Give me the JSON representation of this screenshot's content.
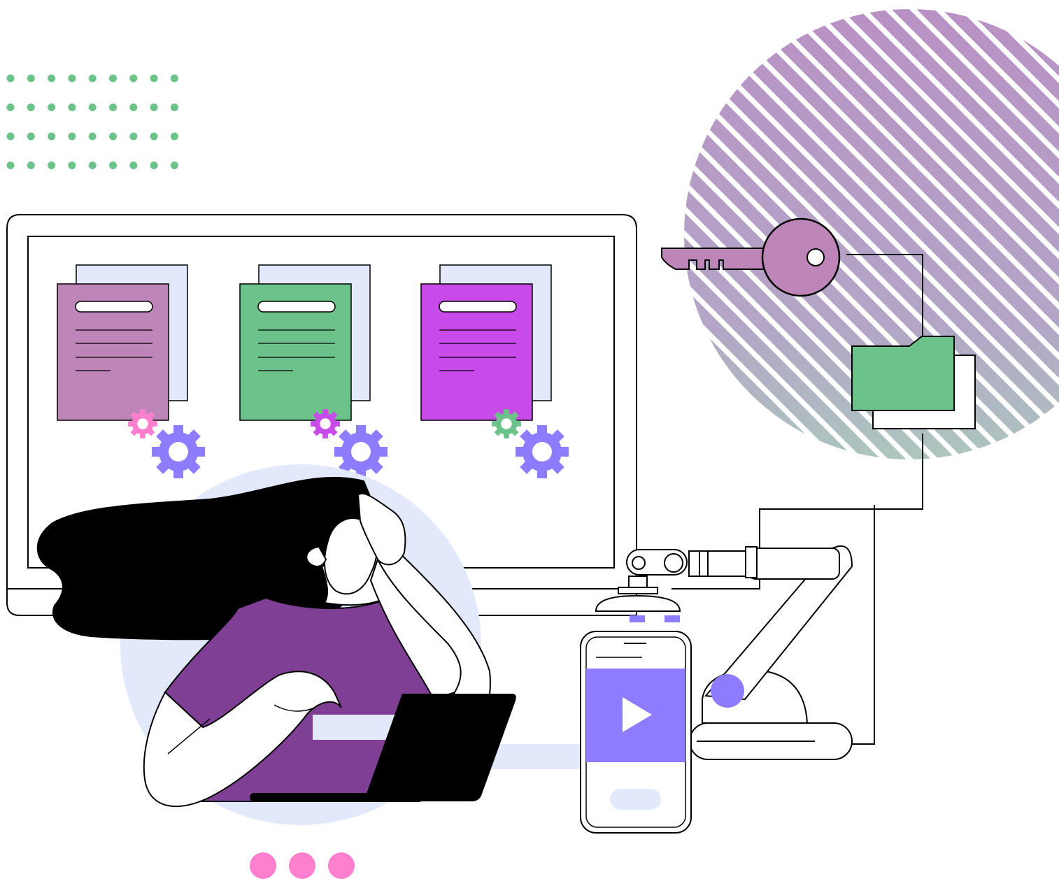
{
  "colors": {
    "green": "#6cc38a",
    "purple_dark": "#7e3f94",
    "purple_dusty": "#bd85b8",
    "magenta": "#c84ae9",
    "violet": "#8e7cff",
    "pink": "#ff7fcf",
    "pale_blue": "#e1e9fb",
    "black": "#000000",
    "white": "#ffffff"
  },
  "icons": {
    "dot_grid": "dot-grid-decoration",
    "striped_circle": "striped-circle-decoration",
    "key": "key-icon",
    "folder": "folder-icon",
    "gear": "gear-icon",
    "document": "document-icon",
    "play": "play-icon",
    "robot_arm": "robot-arm",
    "laptop": "laptop",
    "smartphone": "smartphone",
    "loading_dots": "loading-dots"
  },
  "documents": [
    {
      "name": "document-purple",
      "color": "#bd85b8",
      "gear_small_color": "#ff7fcf"
    },
    {
      "name": "document-green",
      "color": "#6cc38a",
      "gear_small_color": "#c84ae9"
    },
    {
      "name": "document-magenta",
      "color": "#c84ae9",
      "gear_small_color": "#6cc38a"
    }
  ]
}
